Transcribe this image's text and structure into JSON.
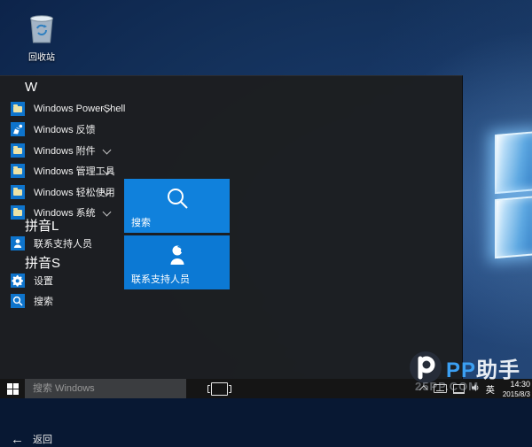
{
  "desktop": {
    "recycle_bin": {
      "label": "回收站"
    }
  },
  "start_menu": {
    "sections": [
      {
        "header": "W",
        "items": [
          {
            "label": "Windows PowerShell",
            "icon": "folder-icon",
            "expandable": true
          },
          {
            "label": "Windows 反馈",
            "icon": "feedback-icon",
            "expandable": false
          },
          {
            "label": "Windows 附件",
            "icon": "folder-icon",
            "expandable": true
          },
          {
            "label": "Windows 管理工具",
            "icon": "folder-icon",
            "expandable": true
          },
          {
            "label": "Windows 轻松使用",
            "icon": "folder-icon",
            "expandable": true
          },
          {
            "label": "Windows 系统",
            "icon": "folder-icon",
            "expandable": true
          }
        ]
      },
      {
        "header": "拼音L",
        "items": [
          {
            "label": "联系支持人员",
            "icon": "contact-icon",
            "expandable": false
          }
        ]
      },
      {
        "header": "拼音S",
        "items": [
          {
            "label": "设置",
            "icon": "gear-icon",
            "expandable": false
          },
          {
            "label": "搜索",
            "icon": "search-icon",
            "expandable": false
          }
        ]
      }
    ],
    "tiles": [
      {
        "label": "搜索",
        "icon": "search-icon"
      },
      {
        "label": "联系支持人员",
        "icon": "contact-headset-icon"
      }
    ],
    "back_label": "返回"
  },
  "taskbar": {
    "search_placeholder": "搜索 Windows",
    "tray": {
      "input_indicator": "英",
      "time": "14:30",
      "date": "2015/8/3"
    }
  },
  "watermark": {
    "brand_blue": "PP",
    "brand_white": "助手",
    "site": "25PP.COM"
  },
  "icons": {
    "back_arrow": "←"
  },
  "colors": {
    "accent": "#0078d7",
    "tile_blue": "#0f7fd9",
    "menu_bg": "#1c1e22",
    "taskbar_bg": "#151515"
  }
}
